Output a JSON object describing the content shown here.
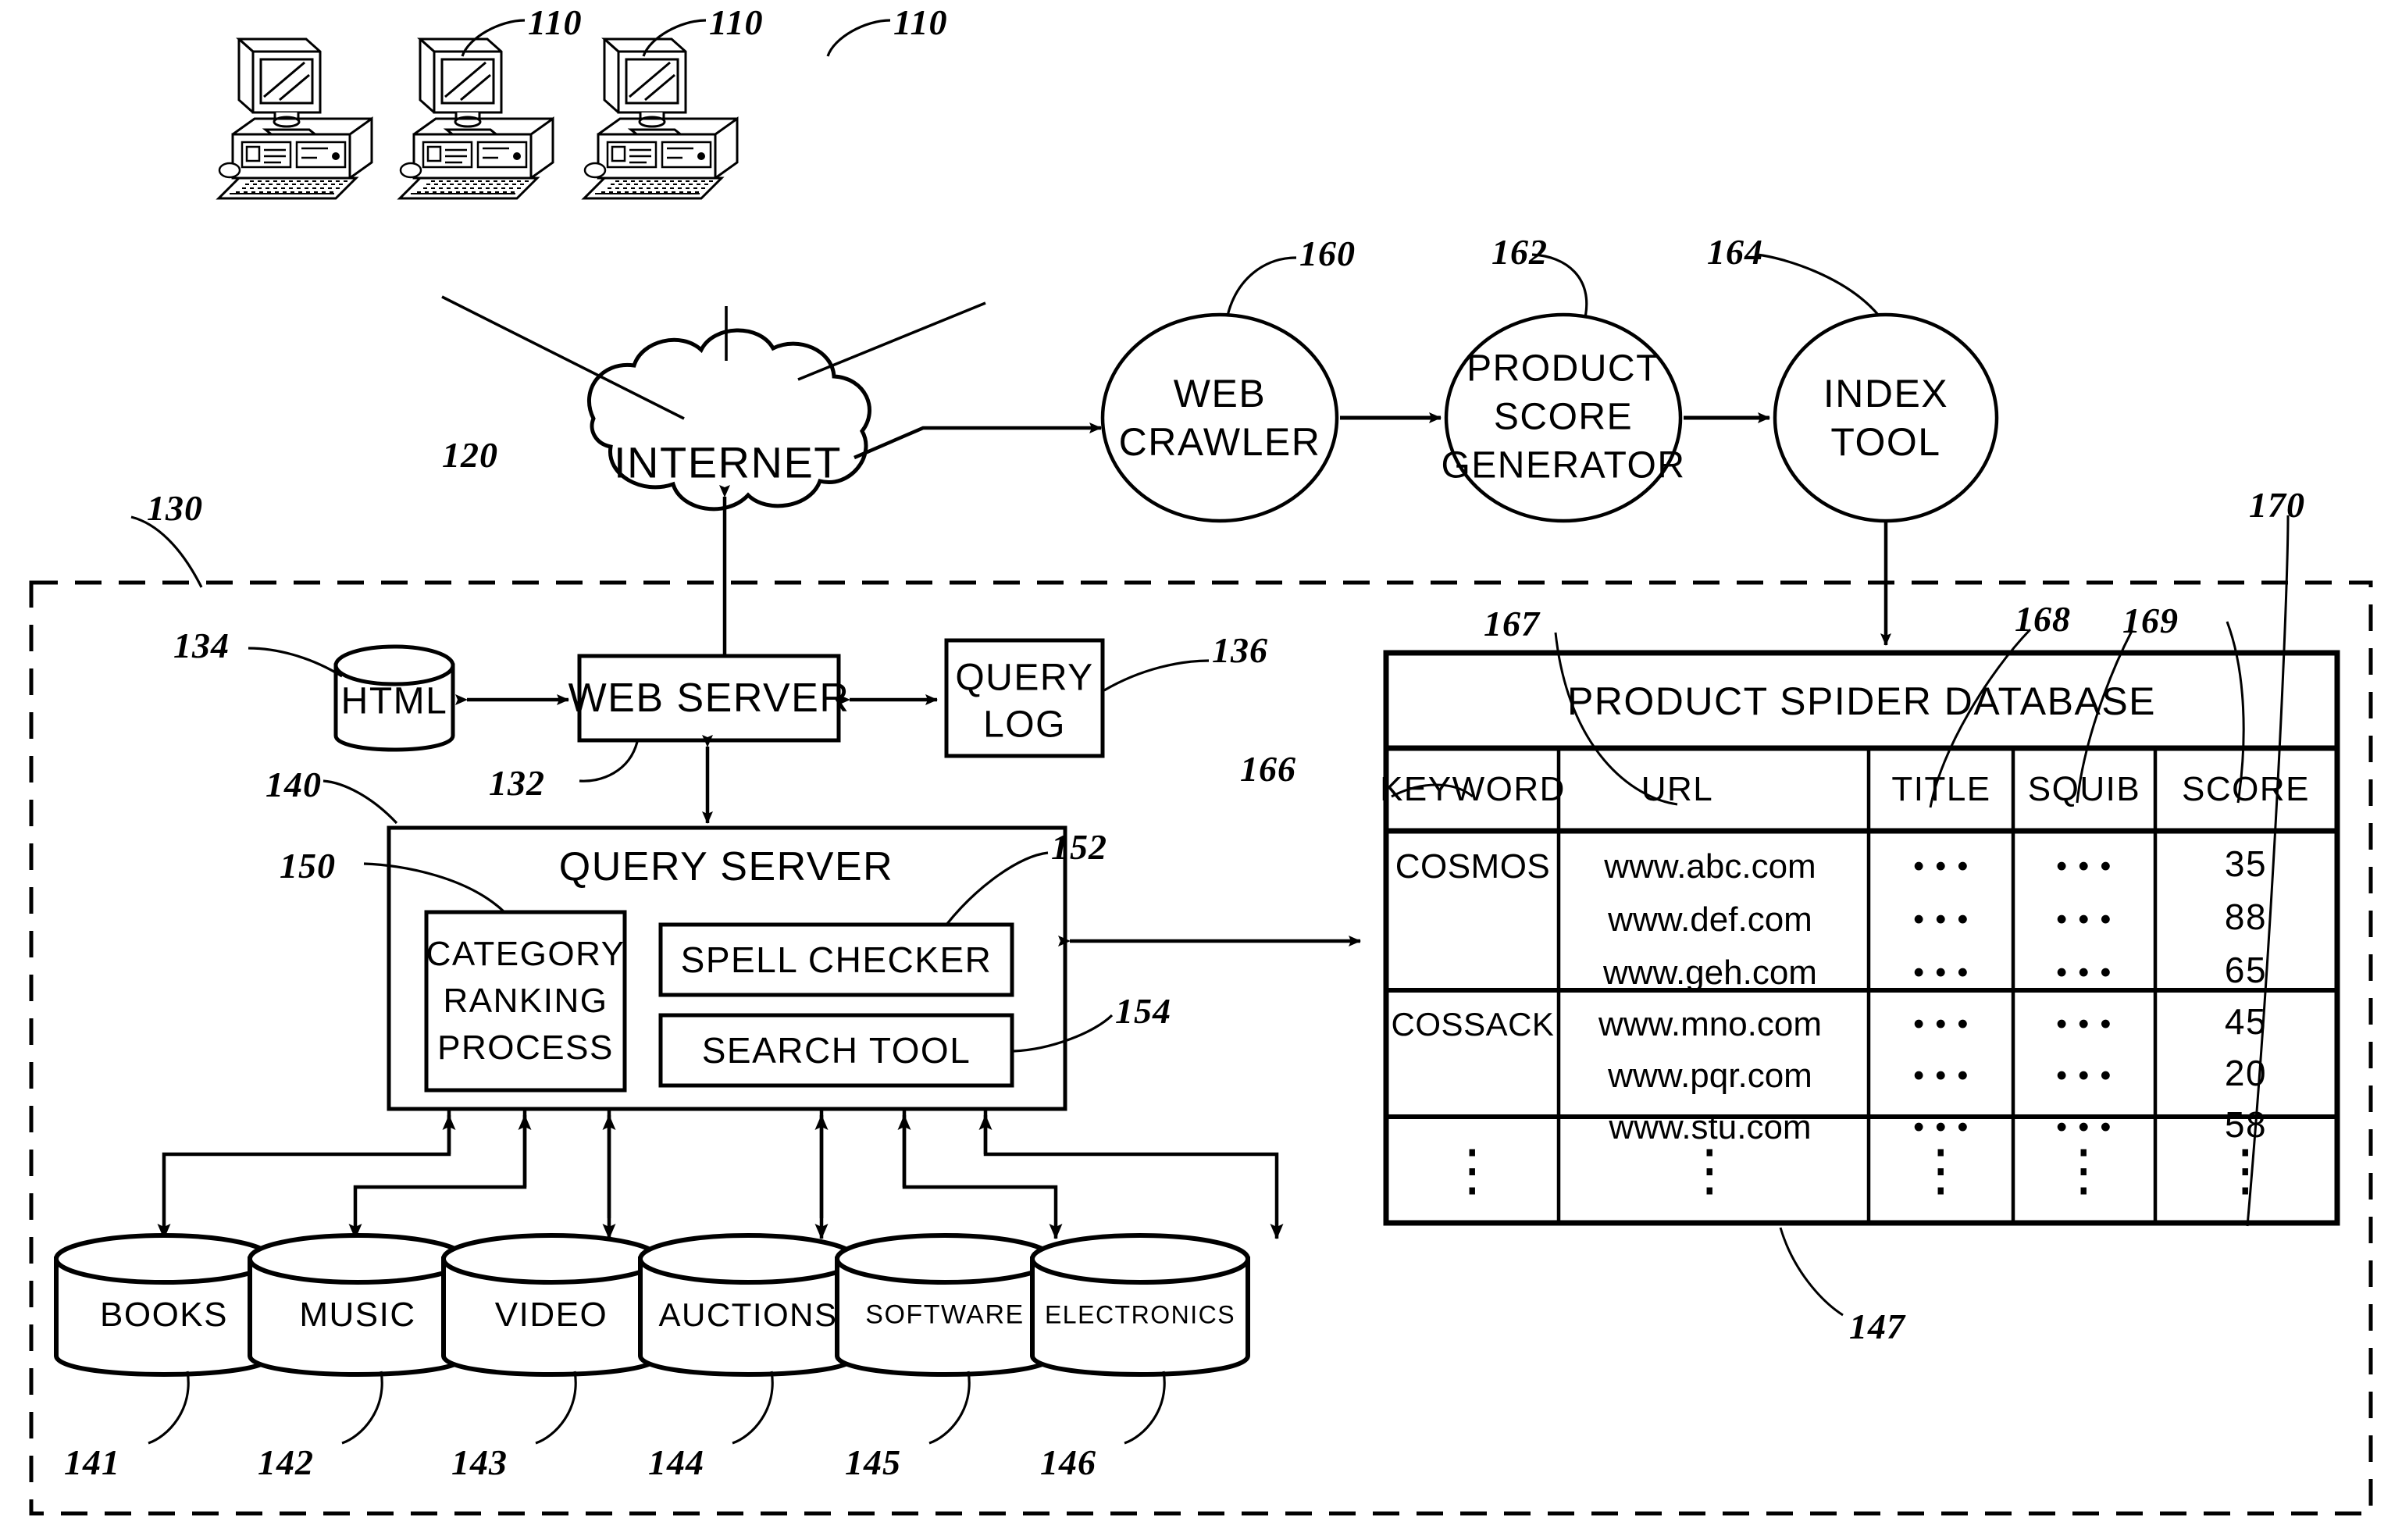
{
  "figure": {
    "title": "Product search system block diagram",
    "kind": "patent-figure"
  },
  "nodes": {
    "clients": [
      {
        "label": "110"
      },
      {
        "label": "110"
      },
      {
        "label": "110"
      }
    ],
    "internet": {
      "label": "INTERNET",
      "ref": "120"
    },
    "boundary": {
      "ref": "130"
    },
    "web_crawler": {
      "label_line1": "WEB",
      "label_line2": "CRAWLER",
      "ref": "160"
    },
    "product_score_generator": {
      "label_line1": "PRODUCT",
      "label_line2": "SCORE",
      "label_line3": "GENERATOR",
      "ref": "162"
    },
    "index_tool": {
      "label_line1": "INDEX",
      "label_line2": "TOOL",
      "ref": "164"
    },
    "html_store": {
      "label": "HTML",
      "ref": "134"
    },
    "web_server": {
      "label": "WEB SERVER",
      "ref": "132"
    },
    "query_log": {
      "label_line1": "QUERY",
      "label_line2": "LOG",
      "ref": "136"
    },
    "query_server": {
      "label": "QUERY SERVER",
      "ref": "140"
    },
    "category_ranking_process": {
      "label_line1": "CATEGORY",
      "label_line2": "RANKING",
      "label_line3": "PROCESS",
      "ref": "150"
    },
    "spell_checker": {
      "label": "SPELL CHECKER",
      "ref": "152"
    },
    "search_tool": {
      "label": "SEARCH  TOOL",
      "ref": "154"
    },
    "category_databases": [
      {
        "label": "BOOKS",
        "ref": "141"
      },
      {
        "label": "MUSIC",
        "ref": "142"
      },
      {
        "label": "VIDEO",
        "ref": "143"
      },
      {
        "label": "AUCTIONS",
        "ref": "144"
      },
      {
        "label": "SOFTWARE",
        "ref": "145"
      },
      {
        "label": "ELECTRONICS",
        "ref": "146"
      }
    ]
  },
  "spider_table": {
    "title": "PRODUCT SPIDER DATABASE",
    "ref_table": "170",
    "ref_rows": "147",
    "column_refs": {
      "keyword": "166",
      "url": "167",
      "title": "168",
      "squib": "169"
    },
    "columns": [
      "KEYWORD",
      "URL",
      "TITLE",
      "SQUIB",
      "SCORE"
    ],
    "groups": [
      {
        "keyword": "COSMOS",
        "rows": [
          {
            "url": "www.abc.com",
            "title": "• • •",
            "squib": "• • •",
            "score": "35"
          },
          {
            "url": "www.def.com",
            "title": "• • •",
            "squib": "• • •",
            "score": "88"
          },
          {
            "url": "www.geh.com",
            "title": "• • •",
            "squib": "• • •",
            "score": "65"
          }
        ]
      },
      {
        "keyword": "COSSACK",
        "rows": [
          {
            "url": "www.mno.com",
            "title": "• • •",
            "squib": "• • •",
            "score": "45"
          },
          {
            "url": "www.pqr.com",
            "title": "• • •",
            "squib": "• • •",
            "score": "20"
          },
          {
            "url": "www.stu.com",
            "title": "• • •",
            "squib": "• • •",
            "score": "58"
          }
        ]
      }
    ],
    "continuation_row": {
      "keyword": "⋮",
      "url": "⋮",
      "title": "⋮",
      "squib": "⋮",
      "score": "⋮"
    }
  },
  "colors": {
    "ink": "#000000",
    "paper": "#ffffff"
  }
}
